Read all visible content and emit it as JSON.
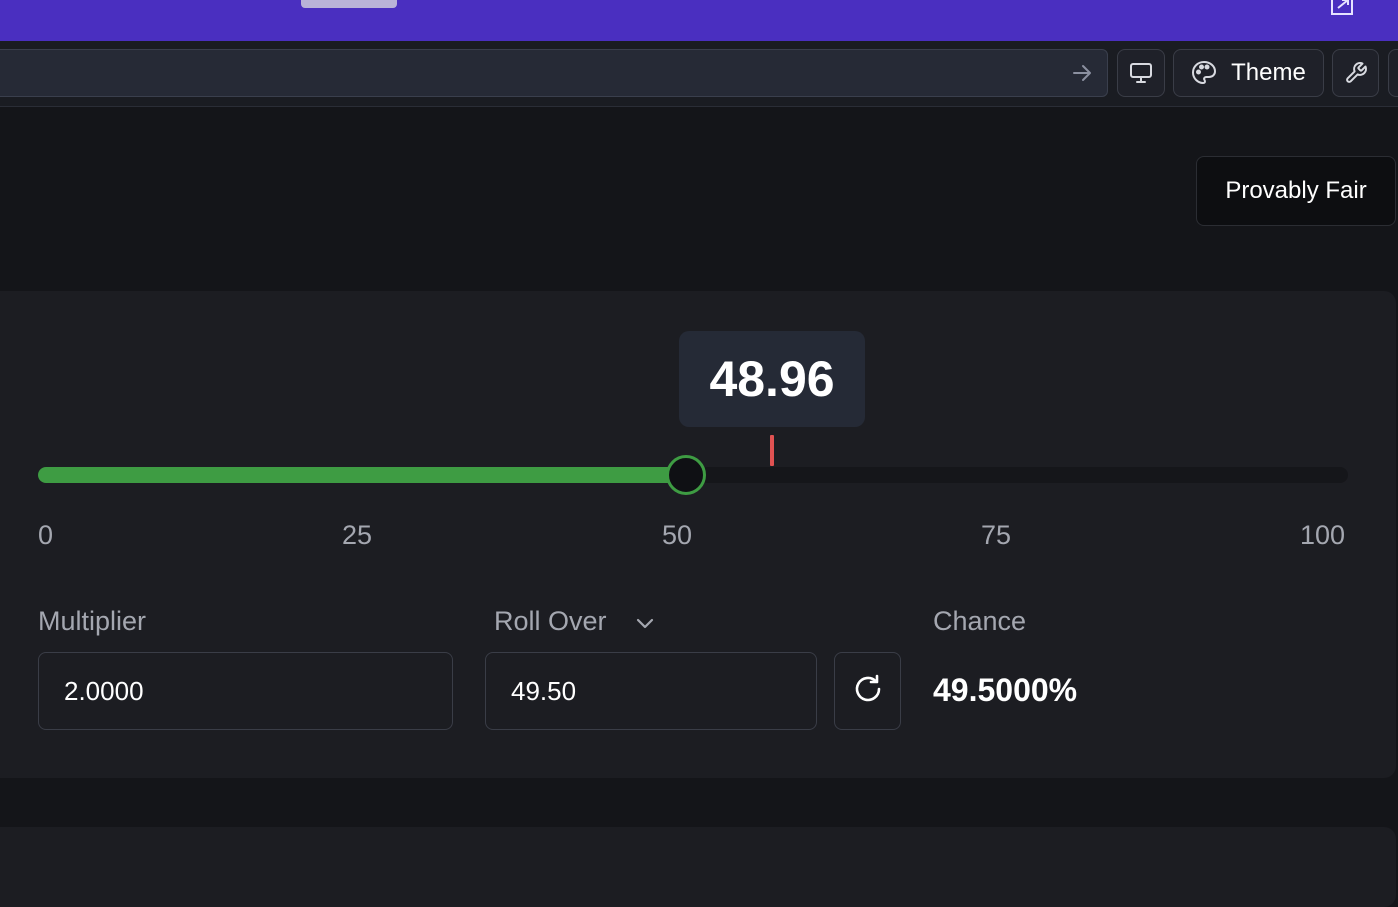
{
  "colors": {
    "topbar": "#4a2fc0",
    "accent_green": "#3e9c43",
    "result_marker": "#e05252",
    "background": "#141519",
    "panel": "#1c1d22"
  },
  "topbar": {
    "popout_icon": "popout-icon"
  },
  "navbar": {
    "go_icon": "arrow-right-icon",
    "desktop_icon": "monitor-icon",
    "theme_icon": "palette-icon",
    "theme_label": "Theme",
    "tools_icon": "wrench-icon"
  },
  "provably_fair_label": "Provably Fair",
  "game": {
    "last_roll": "48.96",
    "last_roll_value": 48.96,
    "slider_value": 49.5,
    "slider_min": 0,
    "slider_max": 100,
    "ticks": [
      "0",
      "25",
      "50",
      "75",
      "100"
    ],
    "multiplier": {
      "label": "Multiplier",
      "value": "2.0000"
    },
    "roll_over": {
      "label": "Roll Over",
      "value": "49.50",
      "chevron_icon": "chevron-down-icon",
      "refresh_icon": "refresh-icon"
    },
    "chance": {
      "label": "Chance",
      "value": "49.5000%"
    }
  }
}
